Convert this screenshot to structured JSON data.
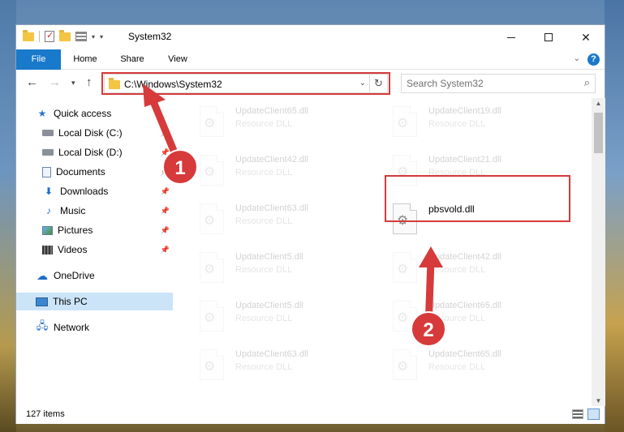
{
  "window": {
    "title": "System32",
    "controls": {
      "minimize": "",
      "maximize": "",
      "close": "✕"
    }
  },
  "ribbon": {
    "tabs": [
      {
        "label": "File"
      },
      {
        "label": "Home"
      },
      {
        "label": "Share"
      },
      {
        "label": "View"
      }
    ],
    "help_label": "?"
  },
  "navigation": {
    "address_path": "C:\\Windows\\System32",
    "search_placeholder": "Search System32"
  },
  "sidebar": {
    "items": [
      {
        "label": "Quick access",
        "icon": "star-icon",
        "pinned": false
      },
      {
        "label": "Local Disk (C:)",
        "icon": "drive-icon",
        "pinned": true
      },
      {
        "label": "Local Disk (D:)",
        "icon": "drive-icon",
        "pinned": true
      },
      {
        "label": "Documents",
        "icon": "documents-icon",
        "pinned": true
      },
      {
        "label": "Downloads",
        "icon": "downloads-icon",
        "pinned": true
      },
      {
        "label": "Music",
        "icon": "music-icon",
        "pinned": true
      },
      {
        "label": "Pictures",
        "icon": "pictures-icon",
        "pinned": true
      },
      {
        "label": "Videos",
        "icon": "videos-icon",
        "pinned": true
      },
      {
        "label": "OneDrive",
        "icon": "onedrive-icon",
        "pinned": false
      },
      {
        "label": "This PC",
        "icon": "this-pc-icon",
        "pinned": false,
        "selected": true
      },
      {
        "label": "Network",
        "icon": "network-icon",
        "pinned": false
      }
    ]
  },
  "files": [
    {
      "name": "UpdateClient65.dll",
      "type": "Resource DLL",
      "highlighted": false
    },
    {
      "name": "UpdateClient19.dll",
      "type": "Resource DLL",
      "highlighted": false
    },
    {
      "name": "UpdateClient42.dll",
      "type": "Resource DLL",
      "highlighted": false
    },
    {
      "name": "UpdateClient21.dll",
      "type": "Resource DLL",
      "highlighted": false
    },
    {
      "name": "UpdateClient63.dll",
      "type": "Resource DLL",
      "highlighted": false
    },
    {
      "name": "pbsvold.dll",
      "type": "",
      "highlighted": true
    },
    {
      "name": "UpdateClient5.dll",
      "type": "Resource DLL",
      "highlighted": false
    },
    {
      "name": "UpdateClient42.dll",
      "type": "Resource DLL",
      "highlighted": false
    },
    {
      "name": "UpdateClient5.dll",
      "type": "Resource DLL",
      "highlighted": false
    },
    {
      "name": "UpdateClient65.dll",
      "type": "Resource DLL",
      "highlighted": false
    },
    {
      "name": "UpdateClient63.dll",
      "type": "Resource DLL",
      "highlighted": false
    },
    {
      "name": "UpdateClient65.dll",
      "type": "Resource DLL",
      "highlighted": false
    }
  ],
  "status": {
    "item_count": "127 items"
  },
  "annotations": {
    "step1": "1",
    "step2": "2",
    "color": "#d63a3a"
  },
  "colors": {
    "accent": "#1979ca",
    "selection": "#cce4f7",
    "highlight": "#d63a3a"
  }
}
